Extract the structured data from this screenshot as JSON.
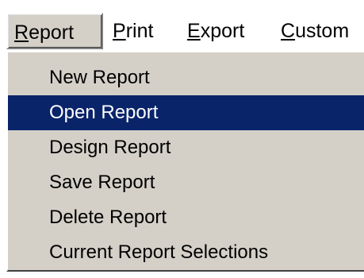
{
  "menubar": {
    "items": [
      {
        "accel": "R",
        "rest": "eport"
      },
      {
        "accel": "P",
        "rest": "rint"
      },
      {
        "accel": "E",
        "rest": "xport"
      },
      {
        "accel": "C",
        "rest": "ustom"
      }
    ]
  },
  "report_menu": {
    "items": [
      {
        "label": "New Report"
      },
      {
        "label": "Open Report"
      },
      {
        "label": "Design Report"
      },
      {
        "label": "Save Report"
      },
      {
        "label": "Delete Report"
      },
      {
        "label": "Current Report Selections"
      }
    ]
  },
  "colors": {
    "menu_background": "#d4d0c8",
    "highlight_background": "#0a246a",
    "highlight_text": "#ffffff"
  }
}
